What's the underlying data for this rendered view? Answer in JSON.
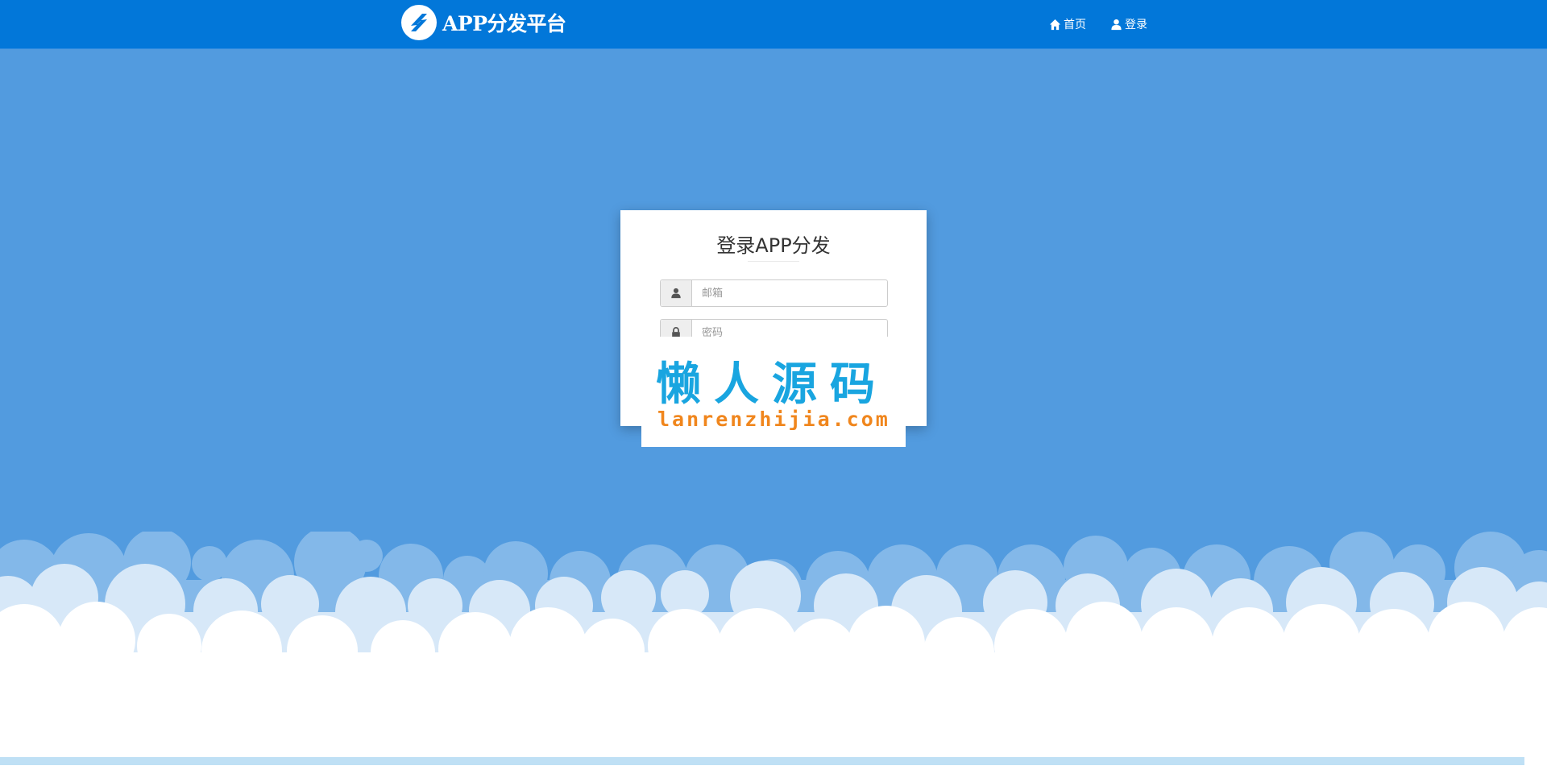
{
  "header": {
    "brand": "APP分发平台",
    "nav": [
      {
        "label": "首页",
        "icon": "home-icon"
      },
      {
        "label": "登录",
        "icon": "user-icon"
      }
    ]
  },
  "login": {
    "title": "登录APP分发",
    "email": {
      "placeholder": "邮箱",
      "value": "",
      "icon": "user-icon"
    },
    "password": {
      "placeholder": "密码",
      "value": "",
      "icon": "lock-icon"
    }
  },
  "watermark": {
    "chars": "懒人源码",
    "url": "lanrenzhijia.com"
  },
  "colors": {
    "header_bg": "#0277d9",
    "page_bg": "#529bdf",
    "watermark_blue": "#19a5e0",
    "watermark_orange": "#f0861d"
  }
}
